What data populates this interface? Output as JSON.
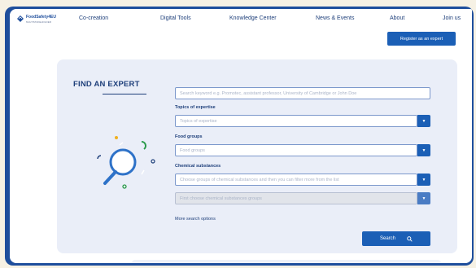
{
  "brand": {
    "title": "FoodSafety4EU",
    "subtitle": "MULTISTAKEHOLDER"
  },
  "nav": {
    "items": [
      "Co-creation",
      "Digital Tools",
      "Knowledge Center",
      "News & Events",
      "About",
      "Join us"
    ]
  },
  "register_button": "Register as an expert",
  "find_expert": {
    "title": "FIND AN EXPERT",
    "keyword_placeholder": "Search keyword e.g. Promotec, assistant professor, University of Cambridge or John Doe",
    "topics_label": "Topics of expertise",
    "topics_placeholder": "Topics of expertise",
    "food_label": "Food groups",
    "food_placeholder": "Food groups",
    "chemical_label": "Chemical substances",
    "chemical_placeholder": "Choose groups of chemical substances and then you can filter more from the list",
    "chemical_sub_placeholder": "First choose chemical substances groups",
    "more_options": "More search options",
    "search_button": "Search"
  },
  "colors": {
    "frame": "#1e4e9c",
    "accent": "#1b5fb6",
    "card": "#eaeef8",
    "background": "#f6f1e4"
  },
  "icons": [
    "logo-icon",
    "chevron-down-icon",
    "search-icon",
    "magnifier-illustration"
  ]
}
